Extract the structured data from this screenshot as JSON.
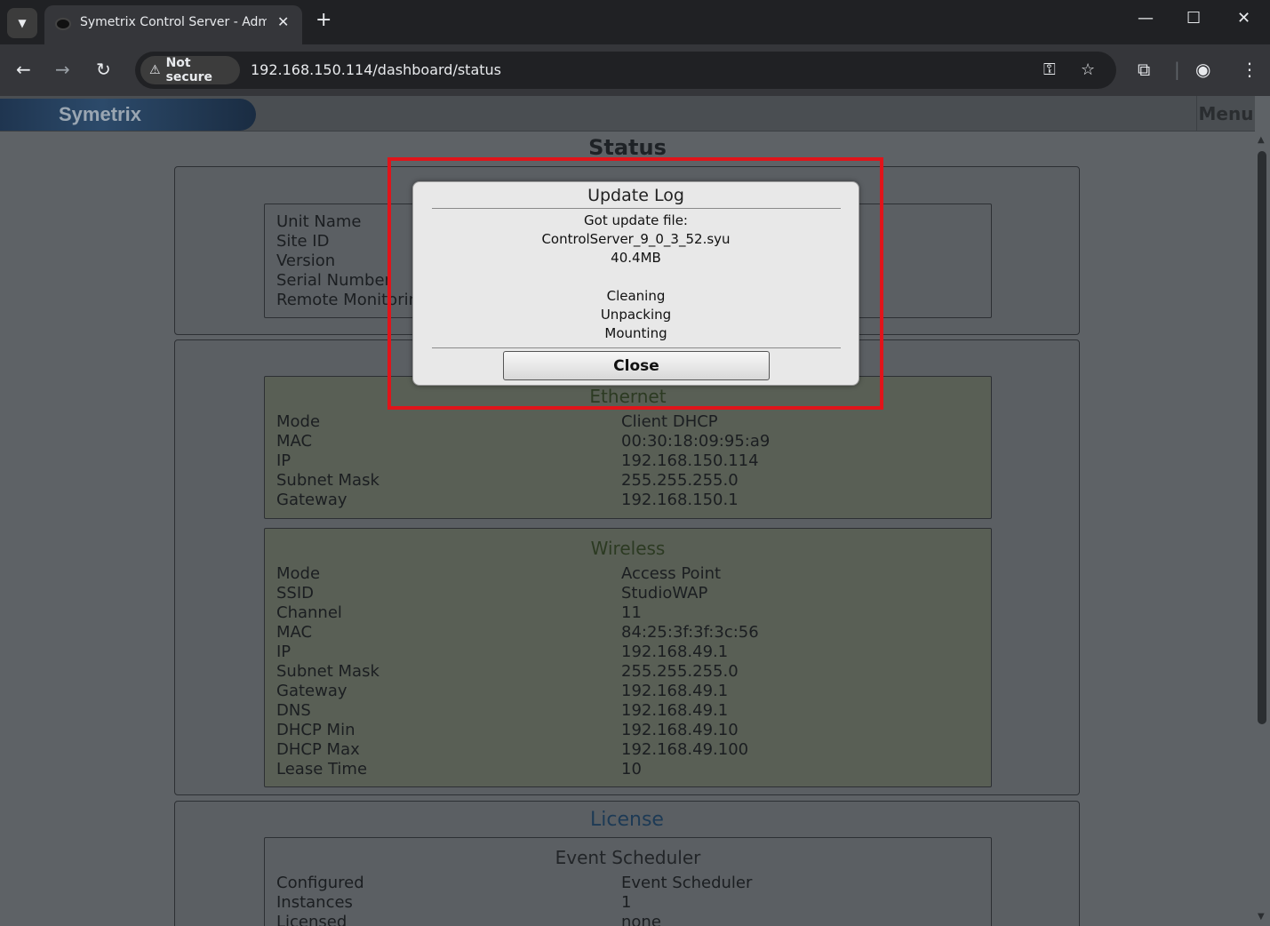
{
  "browser": {
    "tab_title": "Symetrix Control Server - Admin",
    "tab_close": "✕",
    "new_tab": "+",
    "security_label": "Not secure",
    "url": "192.168.150.114/dashboard/status"
  },
  "app": {
    "logo_text": "Symetrix",
    "menu_label": "Menu",
    "page_title": "Status"
  },
  "unit_info": {
    "labels": [
      "Unit Name",
      "Site ID",
      "Version",
      "Serial Number",
      "Remote Monitoring"
    ]
  },
  "ethernet": {
    "title": "Ethernet",
    "rows": [
      {
        "label": "Mode",
        "value": "Client DHCP"
      },
      {
        "label": "MAC",
        "value": "00:30:18:09:95:a9"
      },
      {
        "label": "IP",
        "value": "192.168.150.114"
      },
      {
        "label": "Subnet Mask",
        "value": "255.255.255.0"
      },
      {
        "label": "Gateway",
        "value": "192.168.150.1"
      }
    ]
  },
  "wireless": {
    "title": "Wireless",
    "rows": [
      {
        "label": "Mode",
        "value": "Access Point"
      },
      {
        "label": "SSID",
        "value": "StudioWAP"
      },
      {
        "label": "Channel",
        "value": "11"
      },
      {
        "label": "MAC",
        "value": "84:25:3f:3f:3c:56"
      },
      {
        "label": "IP",
        "value": "192.168.49.1"
      },
      {
        "label": "Subnet Mask",
        "value": "255.255.255.0"
      },
      {
        "label": "Gateway",
        "value": "192.168.49.1"
      },
      {
        "label": "DNS",
        "value": "192.168.49.1"
      },
      {
        "label": "DHCP Min",
        "value": "192.168.49.10"
      },
      {
        "label": "DHCP Max",
        "value": "192.168.49.100"
      },
      {
        "label": "Lease Time",
        "value": "10"
      }
    ]
  },
  "license": {
    "title": "License",
    "card_title": "Event Scheduler",
    "rows": [
      {
        "label": "Configured",
        "value": "Event Scheduler"
      },
      {
        "label": "Instances",
        "value": "1"
      },
      {
        "label": "Licensed",
        "value": "none"
      }
    ]
  },
  "dialog": {
    "title": "Update Log",
    "lines": [
      "Got update file:",
      "ControlServer_9_0_3_52.syu",
      "40.4MB",
      "",
      "Cleaning",
      "Unpacking",
      "Mounting"
    ],
    "close_label": "Close"
  },
  "colors": {
    "highlight": "#e0141a",
    "section_title": "#1d3a55"
  }
}
